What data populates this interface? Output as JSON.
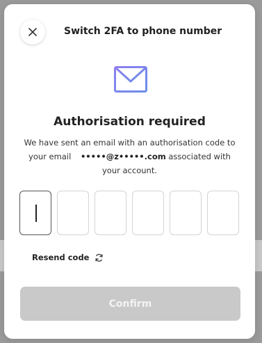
{
  "modal": {
    "title": "Switch 2FA to phone number",
    "close_icon": "close-icon",
    "mail_icon": "envelope-icon"
  },
  "auth": {
    "heading": "Authorisation required",
    "desc_part1": "We have sent an email with an authorisation code to your email",
    "email": "•••••@z•••••.com",
    "desc_part2": "associated with your account."
  },
  "otp": {
    "digit_count": 6,
    "values": [
      "",
      "",
      "",
      "",
      "",
      ""
    ]
  },
  "resend": {
    "label": "Resend code",
    "icon": "refresh-icon"
  },
  "confirm": {
    "label": "Confirm",
    "disabled": true
  },
  "colors": {
    "accent_envelope": "#7b7fe8",
    "button_disabled_bg": "#c9c9c9",
    "button_disabled_text": "#f3f3f3"
  }
}
